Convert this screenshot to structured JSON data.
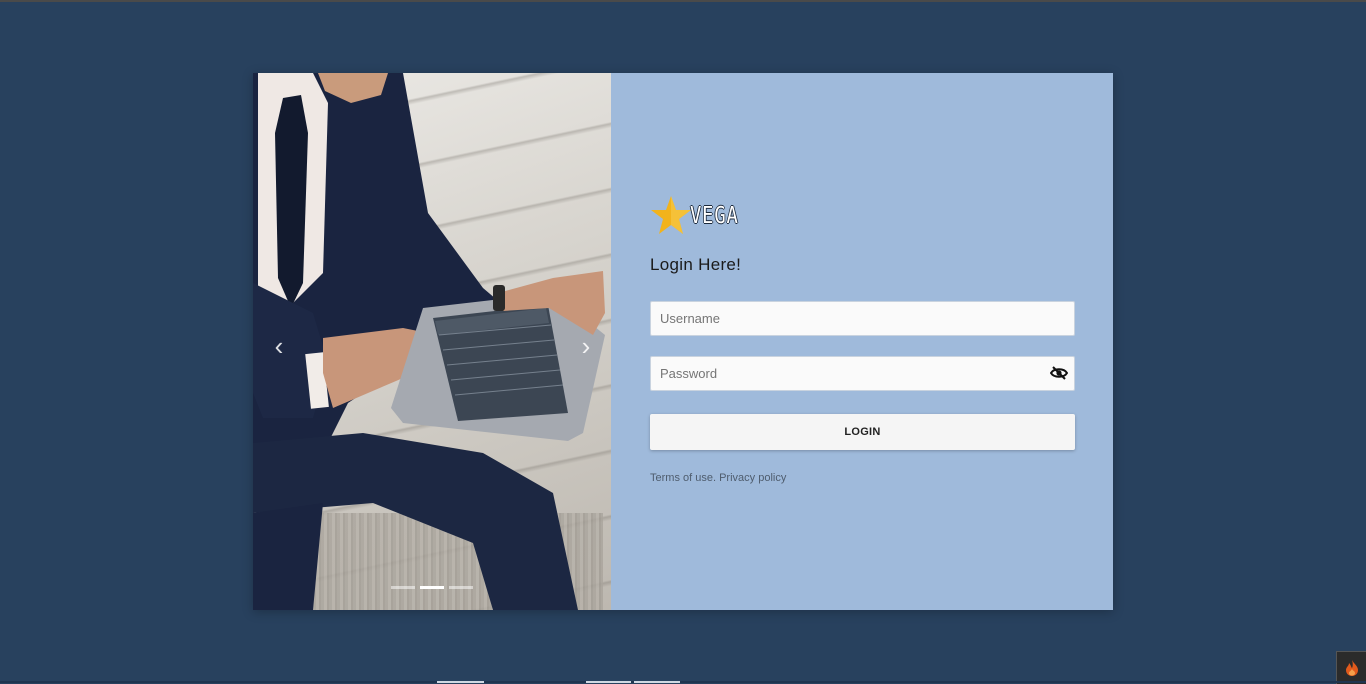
{
  "carousel": {
    "prev_glyph": "‹",
    "next_glyph": "›",
    "slide_count": 3,
    "active_slide": 2
  },
  "brand": {
    "name": "VEGA",
    "star_color": "#f2b31c"
  },
  "login": {
    "title": "Login Here!",
    "username_placeholder": "Username",
    "password_placeholder": "Password",
    "submit_label": "LOGIN",
    "password_toggle_icon": "eye-off-icon"
  },
  "legal": {
    "terms_label": "Terms of use.",
    "privacy_label": "Privacy policy"
  },
  "colors": {
    "page_background": "#28415e",
    "pane_background": "#9fbadb",
    "button_background": "#f5f5f5"
  },
  "widget": {
    "icon": "fire-icon",
    "color": "#e25a1c"
  }
}
